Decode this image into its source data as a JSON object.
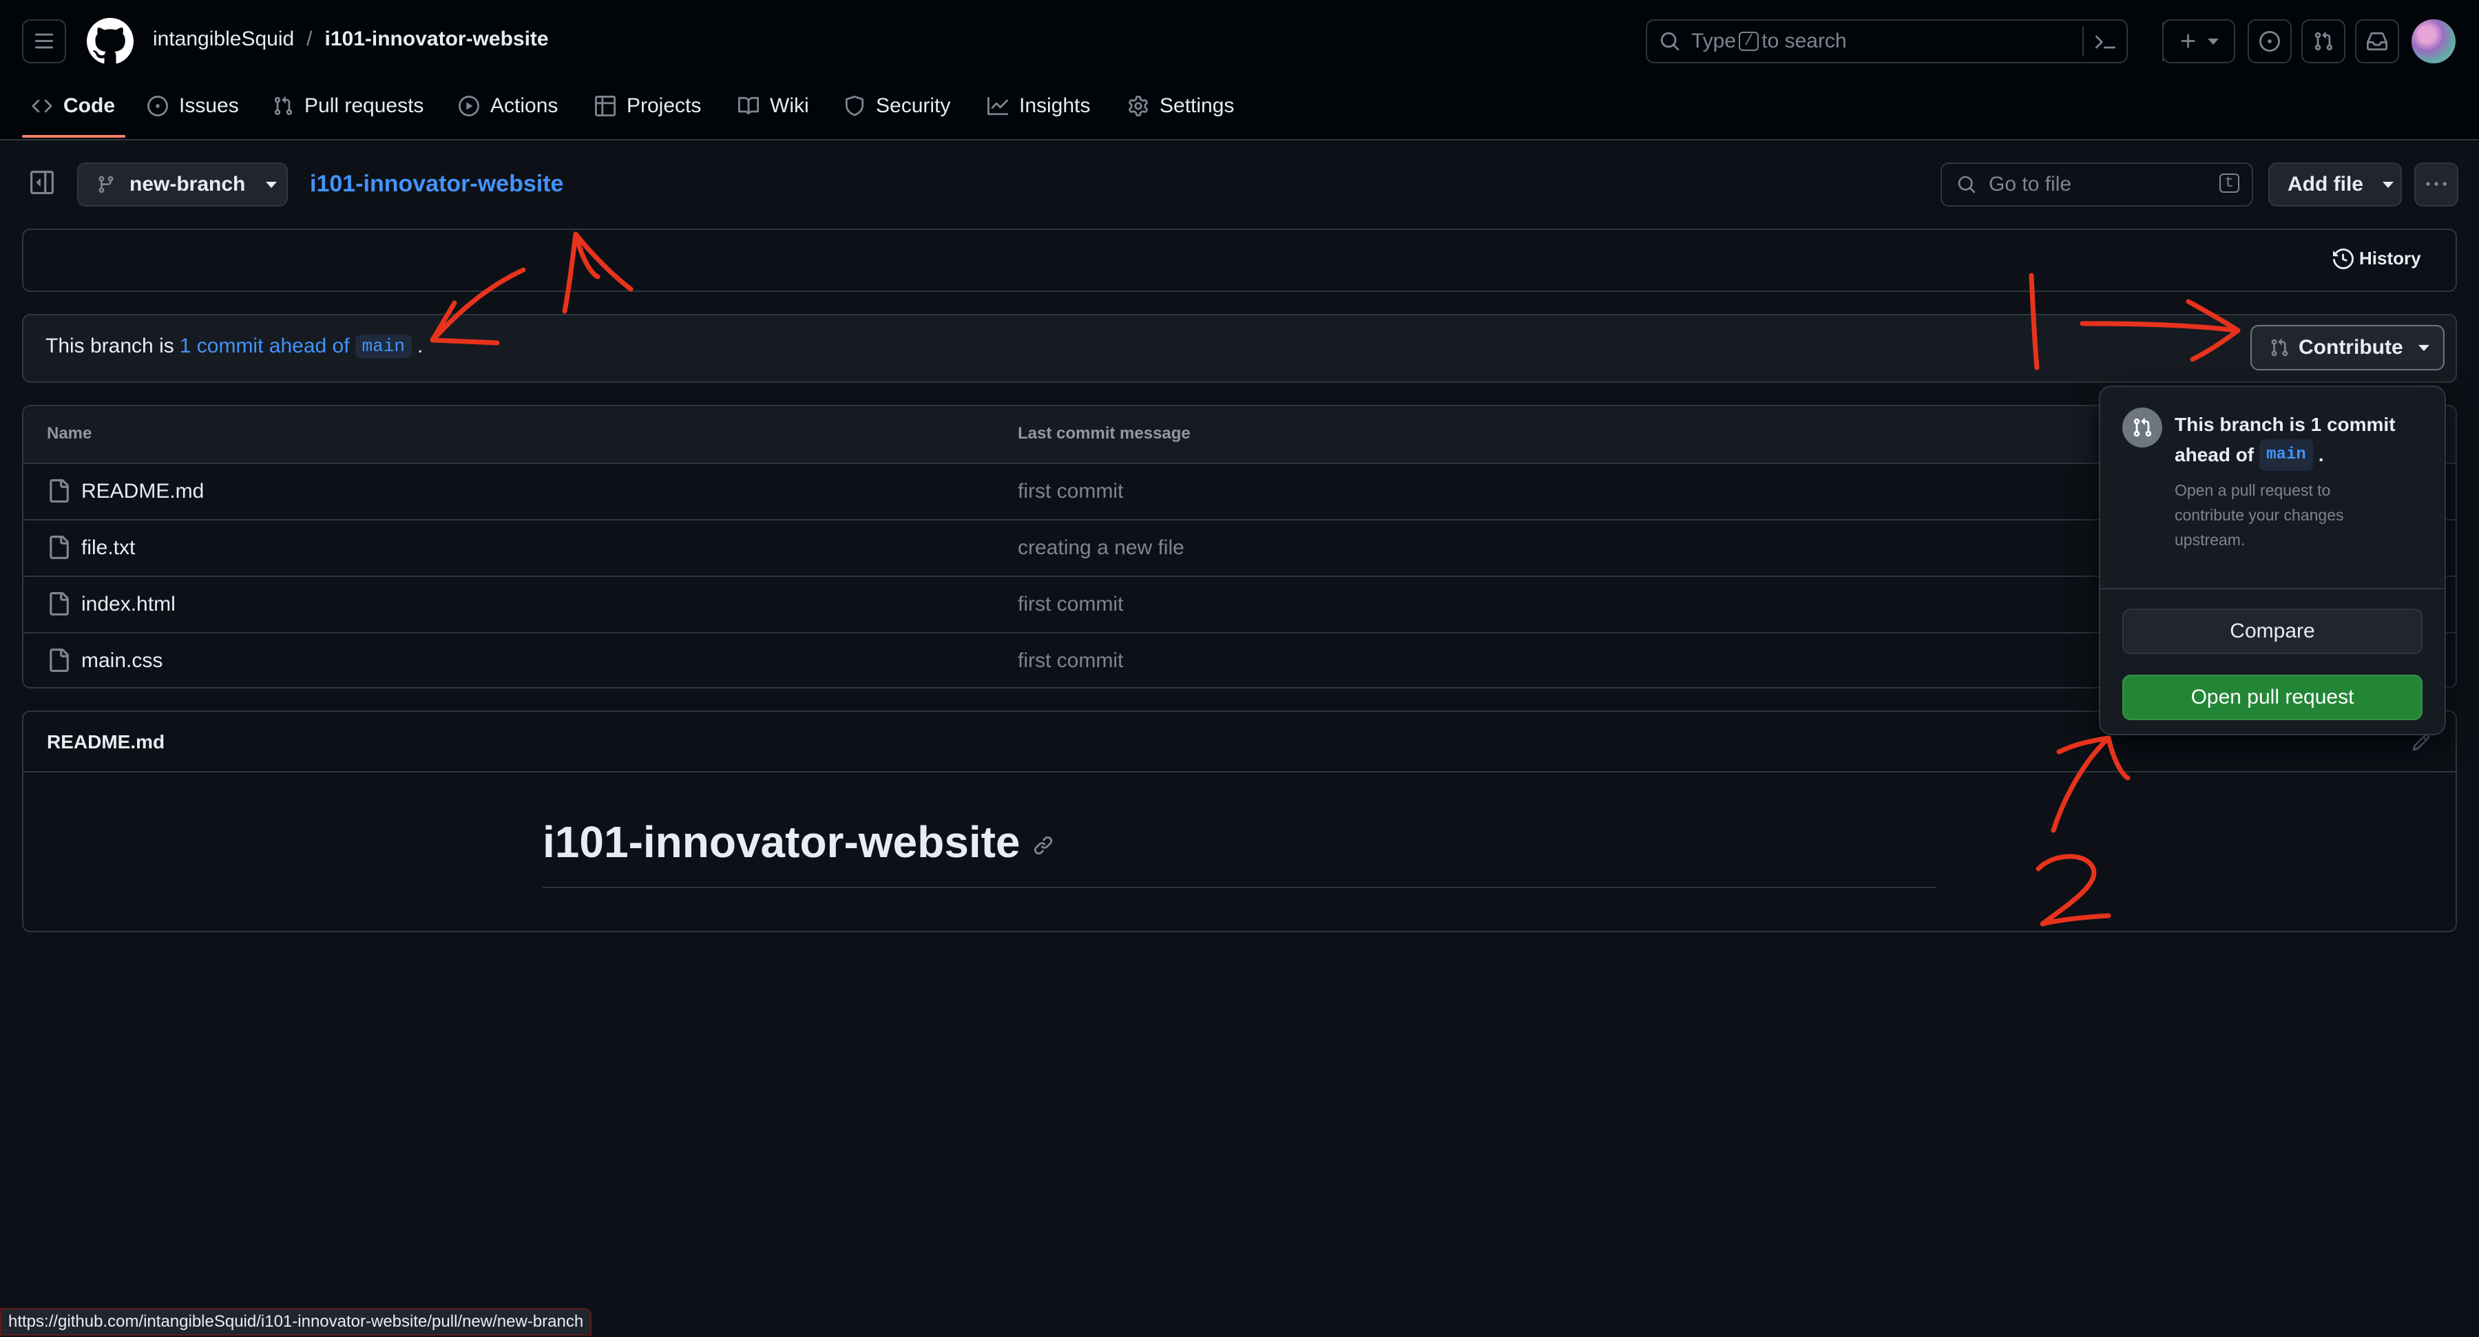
{
  "header": {
    "owner": "intangibleSquid",
    "separator": "/",
    "repo": "i101-innovator-website",
    "search_prefix": "Type",
    "search_key": "/",
    "search_suffix": "to search"
  },
  "tabs": [
    {
      "label": "Code",
      "icon": "code-icon",
      "active": true
    },
    {
      "label": "Issues",
      "icon": "issue-icon"
    },
    {
      "label": "Pull requests",
      "icon": "pull-request-icon"
    },
    {
      "label": "Actions",
      "icon": "play-icon"
    },
    {
      "label": "Projects",
      "icon": "table-icon"
    },
    {
      "label": "Wiki",
      "icon": "book-icon"
    },
    {
      "label": "Security",
      "icon": "shield-icon"
    },
    {
      "label": "Insights",
      "icon": "graph-icon"
    },
    {
      "label": "Settings",
      "icon": "gear-icon"
    }
  ],
  "repo_bar": {
    "branch": "new-branch",
    "repo_link": "i101-innovator-website",
    "goto_placeholder": "Go to file",
    "goto_key": "t",
    "add_file": "Add file"
  },
  "history": {
    "label": "History"
  },
  "branch_status": {
    "prefix": "This branch is",
    "link": "1 commit ahead of",
    "base": "main",
    "suffix": ".",
    "contribute": "Contribute"
  },
  "file_table": {
    "col_name": "Name",
    "col_message": "Last commit message",
    "rows": [
      {
        "name": "README.md",
        "message": "first commit"
      },
      {
        "name": "file.txt",
        "message": "creating a new file"
      },
      {
        "name": "index.html",
        "message": "first commit"
      },
      {
        "name": "main.css",
        "message": "first commit"
      }
    ]
  },
  "readme": {
    "title": "README.md",
    "heading": "i101-innovator-website"
  },
  "contribute_popup": {
    "title_line1": "This branch is 1 commit",
    "title_line2": "ahead of",
    "base": "main",
    "title_end": ".",
    "description_lines": [
      "Open a pull request to",
      "contribute your changes",
      "upstream."
    ],
    "compare": "Compare",
    "open_pr": "Open pull request"
  },
  "status_url": "https://github.com/intangibleSquid/i101-innovator-website/pull/new/new-branch",
  "annotations": {
    "color": "#e8331c",
    "labels": [
      "1",
      "2"
    ]
  },
  "colors": {
    "accent_link": "#4493f8",
    "green": "#238636",
    "tab_underline": "#f78166",
    "background": "#0d1117"
  }
}
